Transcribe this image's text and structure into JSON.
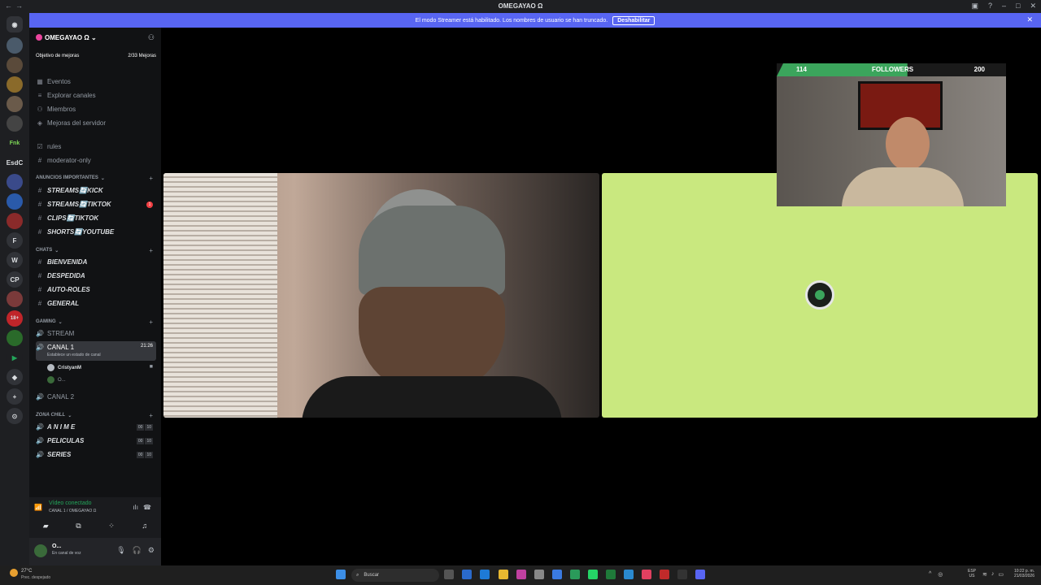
{
  "window": {
    "title": "OMEGAYAO Ω"
  },
  "banner": {
    "text": "El modo Streamer está habilitado. Los nombres de usuario se han truncado.",
    "button": "Deshabilitar"
  },
  "guilds": [
    "EsdC",
    "F",
    "W",
    "CP"
  ],
  "server": {
    "name": "OMEGAYAO Ω",
    "boost_label": "Objetivo de mejoras",
    "boost_count": "2/33 Mejoras"
  },
  "nav": [
    "Eventos",
    "Explorar canales",
    "Miembros",
    "Mejoras del servidor"
  ],
  "channels_top": [
    "rules",
    "moderator-only"
  ],
  "categories": {
    "announcements": "ANUNCIOS IMPORTANTES",
    "chats": "CHATS",
    "gaming": "GAMING",
    "chill": "ZONA CHILL"
  },
  "announce_channels": [
    "STREAMS🔄KICK",
    "STREAMS🔄TIKTOK",
    "CLIPS🔄TIKTOK",
    "SHORTS🔄YOUTUBE"
  ],
  "announce_badge": "1",
  "chat_channels": [
    "BIENVENIDA",
    "DESPEDIDA",
    "AUTO-ROLES",
    "GENERAL"
  ],
  "gaming": {
    "stream": "STREAM",
    "canal1": "CANAL 1",
    "canal1_time": "21:26",
    "canal1_status": "Establece un estado de canal",
    "member1": "CristyanM",
    "member2": "O...",
    "canal2": "CANAL 2"
  },
  "chill_channels": [
    {
      "name": "A N I M E",
      "a": "00",
      "b": "10"
    },
    {
      "name": "PELICULAS",
      "a": "00",
      "b": "10"
    },
    {
      "name": "SERIES",
      "a": "00",
      "b": "10"
    }
  ],
  "voice": {
    "status": "Vídeo conectado",
    "channel": "CANAL 1 / OMEGAYAO Ω"
  },
  "user": {
    "name": "O...",
    "status": "En canal de voz"
  },
  "overlay": {
    "current": "114",
    "label": "FOLLOWERS",
    "goal": "200",
    "progress": 0.57
  },
  "taskbar": {
    "weather_temp": "27°C",
    "weather_desc": "Prec. despejado",
    "search": "Buscar",
    "lang1": "ESP",
    "lang2": "US",
    "time": "10:22 p. m.",
    "date": "21/03/2026"
  },
  "colors": {
    "accent": "#5865f2",
    "green_tile": "#c9e87f",
    "follow_green": "#3ba55c"
  }
}
